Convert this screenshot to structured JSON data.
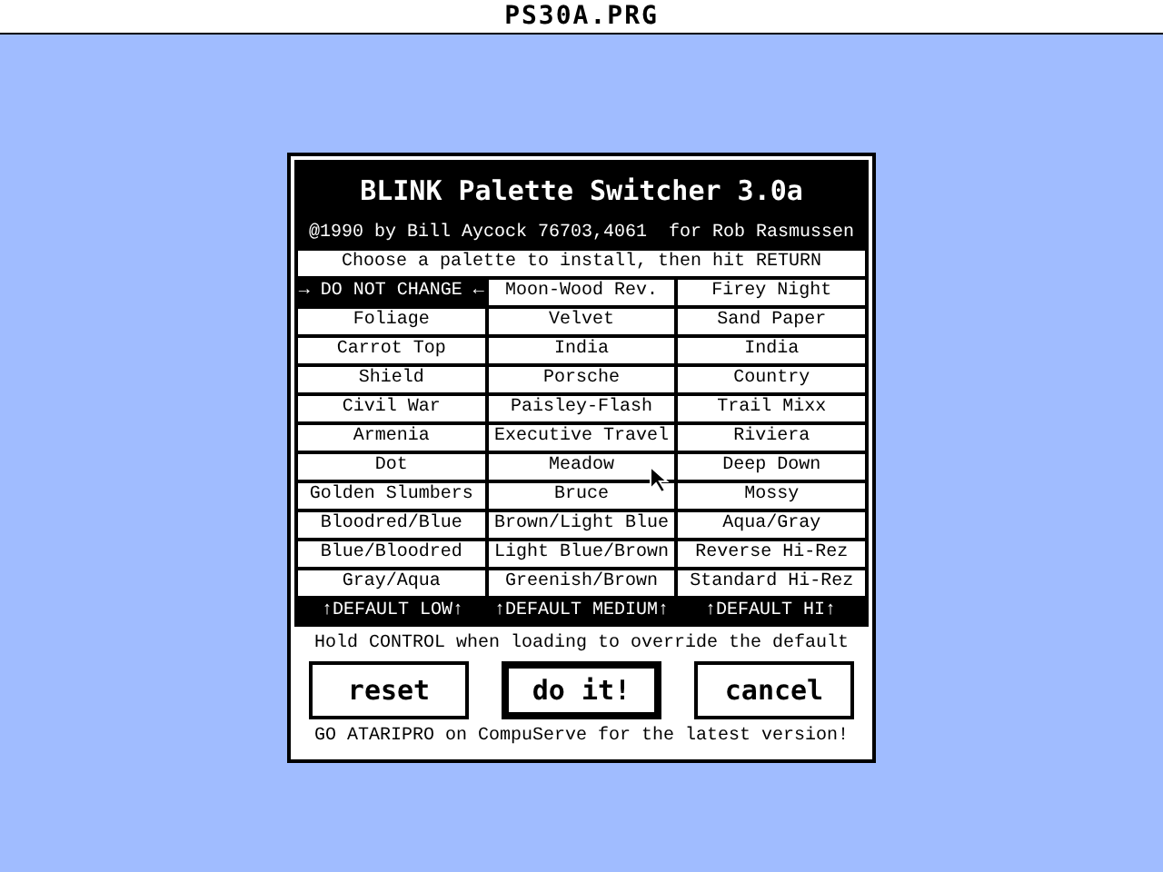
{
  "window": {
    "title": "PS30A.PRG"
  },
  "dialog": {
    "heading": "BLINK Palette Switcher 3.0a",
    "credit": "@1990 by Bill Aycock 76703,4061  for Rob Rasmussen",
    "instruction": "Choose a palette to install, then hit RETURN",
    "palettes": [
      {
        "label": "→ DO NOT CHANGE ←",
        "selected": true
      },
      {
        "label": "Moon-Wood Rev.",
        "selected": false
      },
      {
        "label": "Firey Night",
        "selected": false
      },
      {
        "label": "Foliage",
        "selected": false
      },
      {
        "label": "Velvet",
        "selected": false
      },
      {
        "label": "Sand Paper",
        "selected": false
      },
      {
        "label": "Carrot Top",
        "selected": false
      },
      {
        "label": "India",
        "selected": false
      },
      {
        "label": "India",
        "selected": false
      },
      {
        "label": "Shield",
        "selected": false
      },
      {
        "label": "Porsche",
        "selected": false
      },
      {
        "label": "Country",
        "selected": false
      },
      {
        "label": "Civil War",
        "selected": false
      },
      {
        "label": "Paisley-Flash",
        "selected": false
      },
      {
        "label": "Trail Mixx",
        "selected": false
      },
      {
        "label": "Armenia",
        "selected": false
      },
      {
        "label": "Executive Travel",
        "selected": false
      },
      {
        "label": "Riviera",
        "selected": false
      },
      {
        "label": "Dot",
        "selected": false
      },
      {
        "label": "Meadow",
        "selected": false
      },
      {
        "label": "Deep Down",
        "selected": false
      },
      {
        "label": "Golden Slumbers",
        "selected": false
      },
      {
        "label": "Bruce",
        "selected": false
      },
      {
        "label": "Mossy",
        "selected": false
      },
      {
        "label": "Bloodred/Blue",
        "selected": false
      },
      {
        "label": "Brown/Light Blue",
        "selected": false
      },
      {
        "label": "Aqua/Gray",
        "selected": false
      },
      {
        "label": "Blue/Bloodred",
        "selected": false
      },
      {
        "label": "Light Blue/Brown",
        "selected": false
      },
      {
        "label": "Reverse Hi-Rez",
        "selected": false
      },
      {
        "label": "Gray/Aqua",
        "selected": false
      },
      {
        "label": "Greenish/Brown",
        "selected": false
      },
      {
        "label": "Standard Hi-Rez",
        "selected": false
      }
    ],
    "defaults": [
      "↑DEFAULT LOW↑",
      "↑DEFAULT MEDIUM↑",
      "↑DEFAULT HI↑"
    ],
    "hint": "Hold CONTROL when loading to override the default",
    "buttons": [
      {
        "label": "reset",
        "default": false
      },
      {
        "label": "do it!",
        "default": true
      },
      {
        "label": "cancel",
        "default": false
      }
    ],
    "footer": "GO ATARIPRO on CompuServe for the latest version!"
  }
}
